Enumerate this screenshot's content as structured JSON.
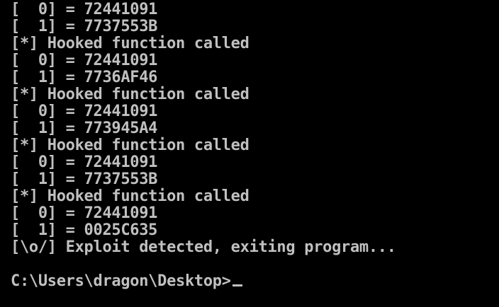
{
  "console": {
    "lines": [
      "[  0] = 72441091",
      "[  1] = 7737553B",
      "[*] Hooked function called",
      "[  0] = 72441091",
      "[  1] = 7736AF46",
      "[*] Hooked function called",
      "[  0] = 72441091",
      "[  1] = 773945A4",
      "[*] Hooked function called",
      "[  0] = 72441091",
      "[  1] = 7737553B",
      "[*] Hooked function called",
      "[  0] = 72441091",
      "[  1] = 0025C635",
      "[\\o/] Exploit detected, exiting program...",
      "",
      "C:\\Users\\dragon\\Desktop>"
    ]
  },
  "colors": {
    "background": "#000000",
    "text": "#c0c0c0"
  }
}
